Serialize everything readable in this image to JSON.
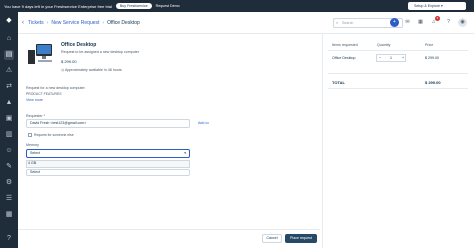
{
  "topbar": {
    "trial_text": "You have 9 days left in your Freshservice Enterprise free trial",
    "buy_label": "Buy Freshservice",
    "demo_label": "Request Demo",
    "setup_label": "Setup & Explore"
  },
  "sidebar": {
    "icons": [
      "logo-icon",
      "dashboard-icon",
      "ticket-icon",
      "problem-icon",
      "change-icon",
      "release-icon",
      "asset-icon",
      "report-icon",
      "contact-icon",
      "tool-icon",
      "settings-icon",
      "admin-icon",
      "apps-icon",
      "help-icon"
    ]
  },
  "header": {
    "crumb1": "Tickets",
    "crumb2": "New Service Request",
    "current": "Office Desktop",
    "search_placeholder": "Search",
    "new_badge": "5"
  },
  "product": {
    "title": "Office Desktop",
    "description": "Request to be assigned a new desktop computer",
    "price": "$ 299.00",
    "availability": "Approximately available in 48 hours",
    "request_text": "Request for a new desktop computer.",
    "features_label": "PRODUCT FEATURES",
    "view_more": "View more"
  },
  "form": {
    "requester_label": "Requester *",
    "requester_value": "David Fresh <test123@gmail.com>",
    "add_cc": "Add cc",
    "someone_else": "Request for someone else",
    "memory_label": "Memory",
    "memory_value": "Select",
    "dropdown_option": "4 GB",
    "select2_value": "Select"
  },
  "footer": {
    "cancel_label": "Cancel",
    "place_label": "Place request"
  },
  "summary": {
    "col_item": "Items requested",
    "col_qty": "Quantity",
    "col_price": "Price",
    "item_name": "Office Desktop",
    "item_qty": "1",
    "item_price": "$ 299.00",
    "total_label": "TOTAL",
    "total_value": "$ 299.00"
  }
}
